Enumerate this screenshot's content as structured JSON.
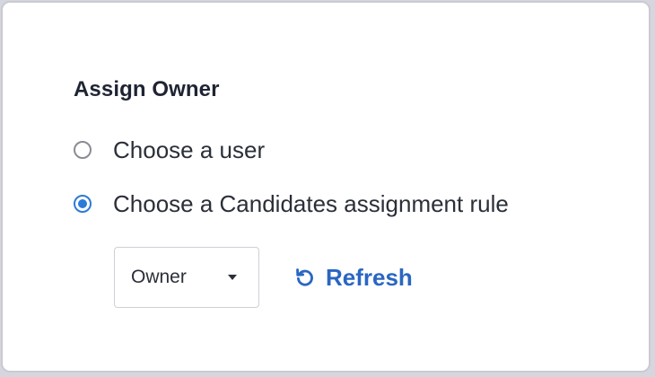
{
  "assign_owner": {
    "title": "Assign Owner",
    "options": [
      {
        "label": "Choose a user",
        "selected": false
      },
      {
        "label": "Choose a Candidates assignment rule",
        "selected": true
      }
    ],
    "rule_select": {
      "value": "Owner"
    },
    "refresh_label": "Refresh",
    "accent_color": "#2c7bd6",
    "link_color": "#2a66c2",
    "icons": {
      "refresh": "refresh-icon",
      "caret": "chevron-down-icon"
    }
  }
}
